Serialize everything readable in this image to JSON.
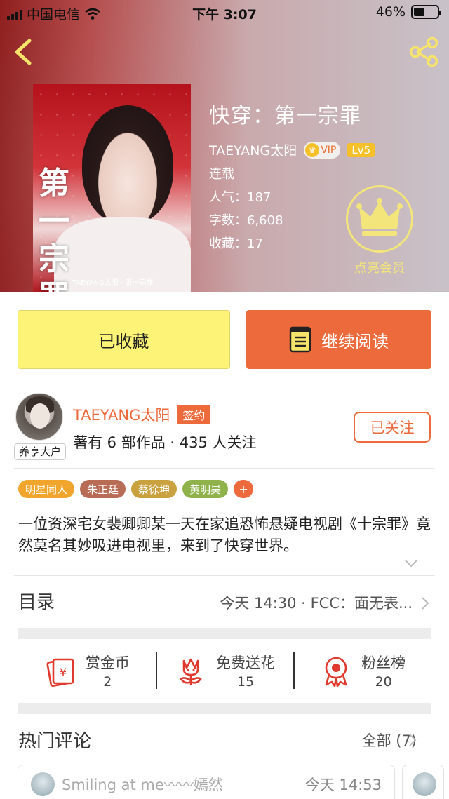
{
  "status": {
    "carrier": "中国电信",
    "time": "下午 3:07",
    "battery": "46%",
    "battery_level": 0.46
  },
  "nav": {
    "back_icon": "chevron-left-icon",
    "share_icon": "share-icon"
  },
  "cover": {
    "title": "第一宗罪",
    "caption": "TAEYANG太阳 · 第一宗罪"
  },
  "book": {
    "title": "快穿：第一宗罪",
    "author": "TAEYANG太阳",
    "vip": "VIP",
    "level": "Lv5",
    "status": "连载",
    "popularity": "人气：187",
    "words": "字数：6,608",
    "favorites": "收藏：17"
  },
  "member": {
    "label": "点亮会员"
  },
  "actions": {
    "favorited": "已收藏",
    "continue": "继续阅读"
  },
  "author": {
    "name": "TAEYANG太阳",
    "signed": "签约",
    "avatar_tag": "养亨大户",
    "stats": "著有 6 部作品 · 435 人关注",
    "follow": "已关注"
  },
  "tags": [
    {
      "label": "明星同人",
      "color": "#f1a52c"
    },
    {
      "label": "朱正廷",
      "color": "#b86b55"
    },
    {
      "label": "蔡徐坤",
      "color": "#c9a13e"
    },
    {
      "label": "黄明昊",
      "color": "#8fb24a"
    },
    {
      "label": "+",
      "color": "#ec6a3c"
    }
  ],
  "description": "一位资深宅女裴卿卿某一天在家追恐怖悬疑电视剧《十宗罪》竟然莫名其妙吸进电视里，来到了快穿世界。",
  "toc": {
    "title": "目录",
    "latest": "今天 14:30 · FCC：面无表..."
  },
  "rewards": [
    {
      "label": "赏金币",
      "count": "2",
      "icon": "coin-envelope-icon"
    },
    {
      "label": "免费送花",
      "count": "15",
      "icon": "flower-icon"
    },
    {
      "label": "粉丝榜",
      "count": "20",
      "icon": "ribbon-medal-icon"
    }
  ],
  "comments": {
    "title": "热门评论",
    "all": "全部 (7)",
    "first": {
      "name": "Smiling at me〰〰嫣然",
      "time": "今天 14:53"
    }
  },
  "colors": {
    "accent": "#ec6a3c",
    "favorite_button": "#fdf377",
    "member_gold": "#f3e57a"
  }
}
